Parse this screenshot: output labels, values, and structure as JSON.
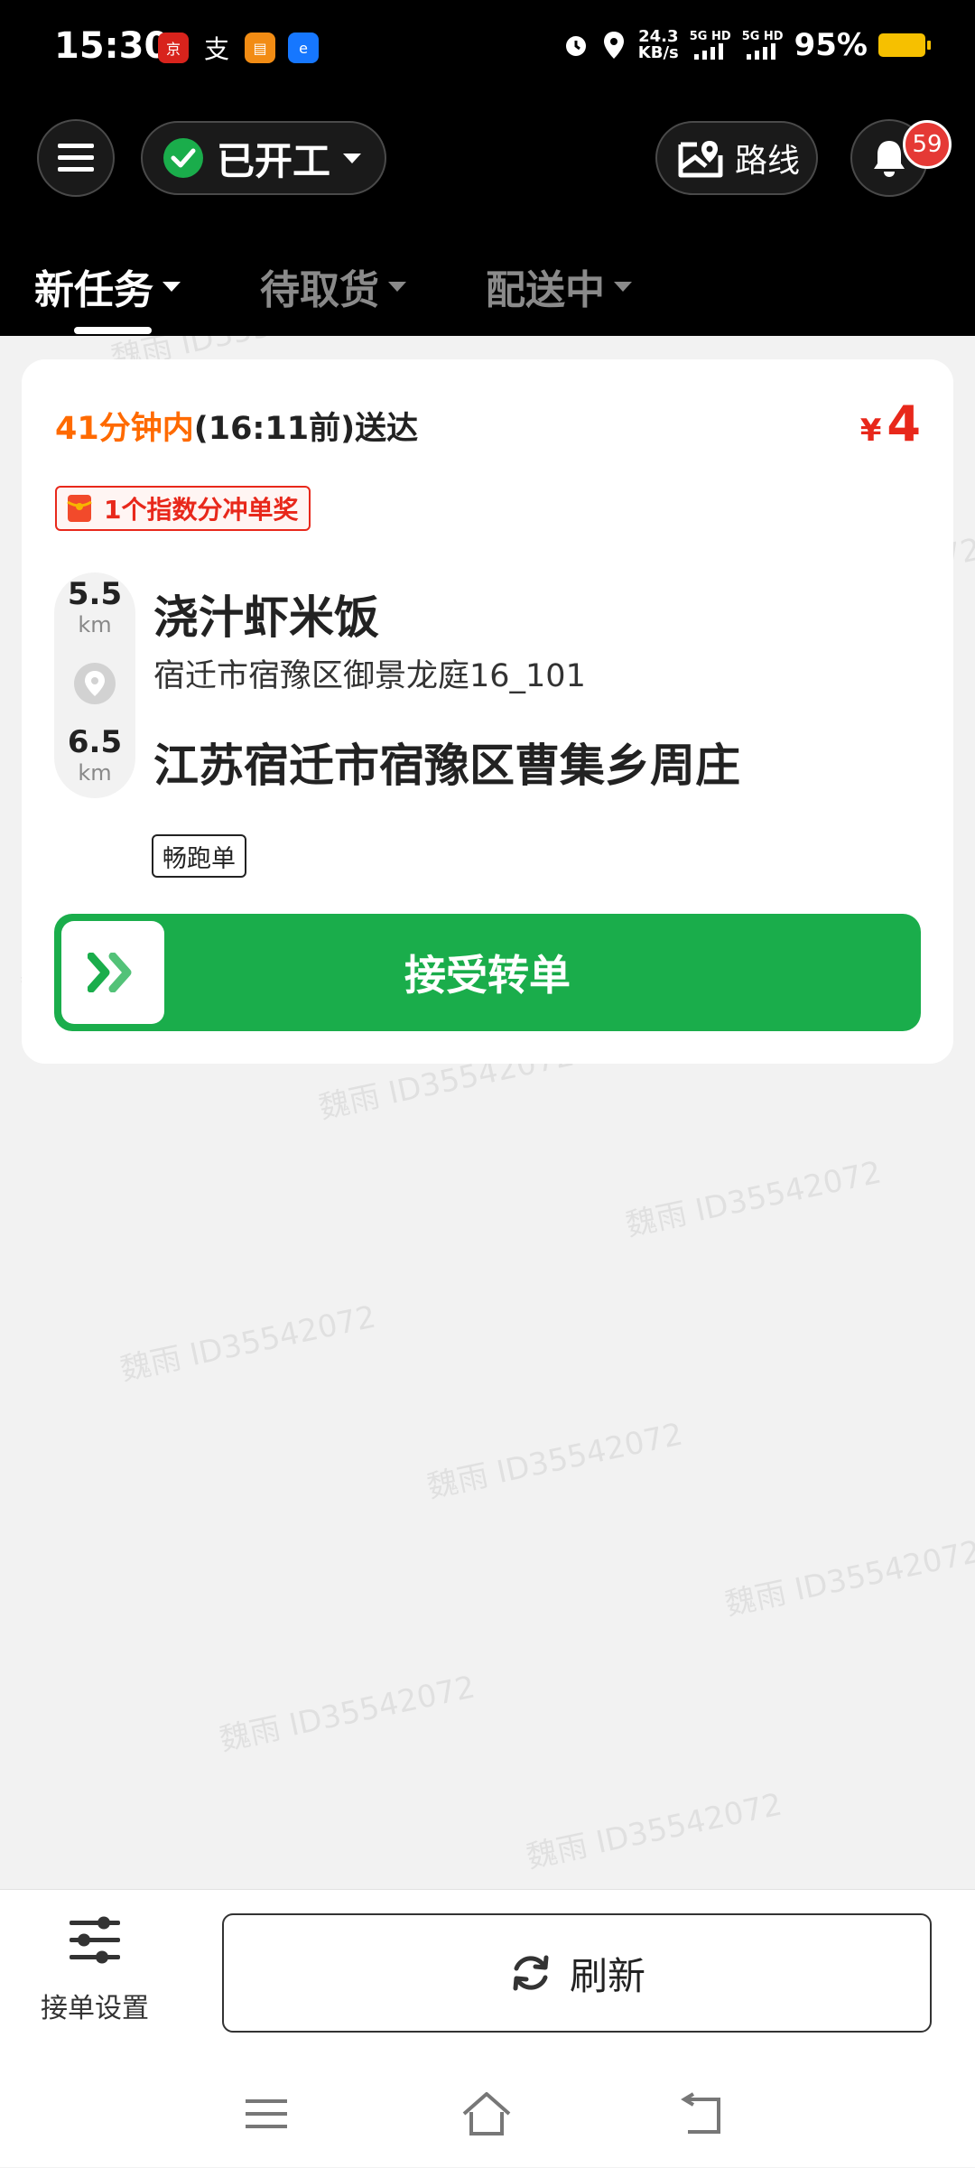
{
  "status_bar": {
    "time": "15:30",
    "speed_value": "24.3",
    "speed_unit": "KB/s",
    "network_1": "5G HD",
    "network_2": "5G HD",
    "battery": "95%"
  },
  "header": {
    "status_label": "已开工",
    "route_label": "路线",
    "notification_count": "59"
  },
  "tabs": [
    {
      "label": "新任务",
      "active": true
    },
    {
      "label": "待取货",
      "active": false
    },
    {
      "label": "配送中",
      "active": false
    }
  ],
  "order": {
    "time_highlight": "41分钟内",
    "time_rest": "(16:11前)送达",
    "price_symbol": "¥",
    "price_value": "4",
    "bonus_text": "1个指数分冲单奖",
    "pickup_distance": "5.5",
    "pickup_unit": "km",
    "pickup_name": "浇汁虾米饭",
    "pickup_address": "宿迁市宿豫区御景龙庭16_101",
    "delivery_distance": "6.5",
    "delivery_unit": "km",
    "delivery_address": "江苏宿迁市宿豫区曹集乡周庄",
    "tag": "畅跑单",
    "accept_label": "接受转单"
  },
  "bottom": {
    "settings_label": "接单设置",
    "refresh_label": "刷新"
  },
  "watermark": "魏雨 ID35542072",
  "colors": {
    "accent_green": "#1aad4b",
    "price_red": "#e8281b",
    "time_orange": "#ff6a00",
    "header_bg": "#000000",
    "badge_red": "#e53935"
  }
}
